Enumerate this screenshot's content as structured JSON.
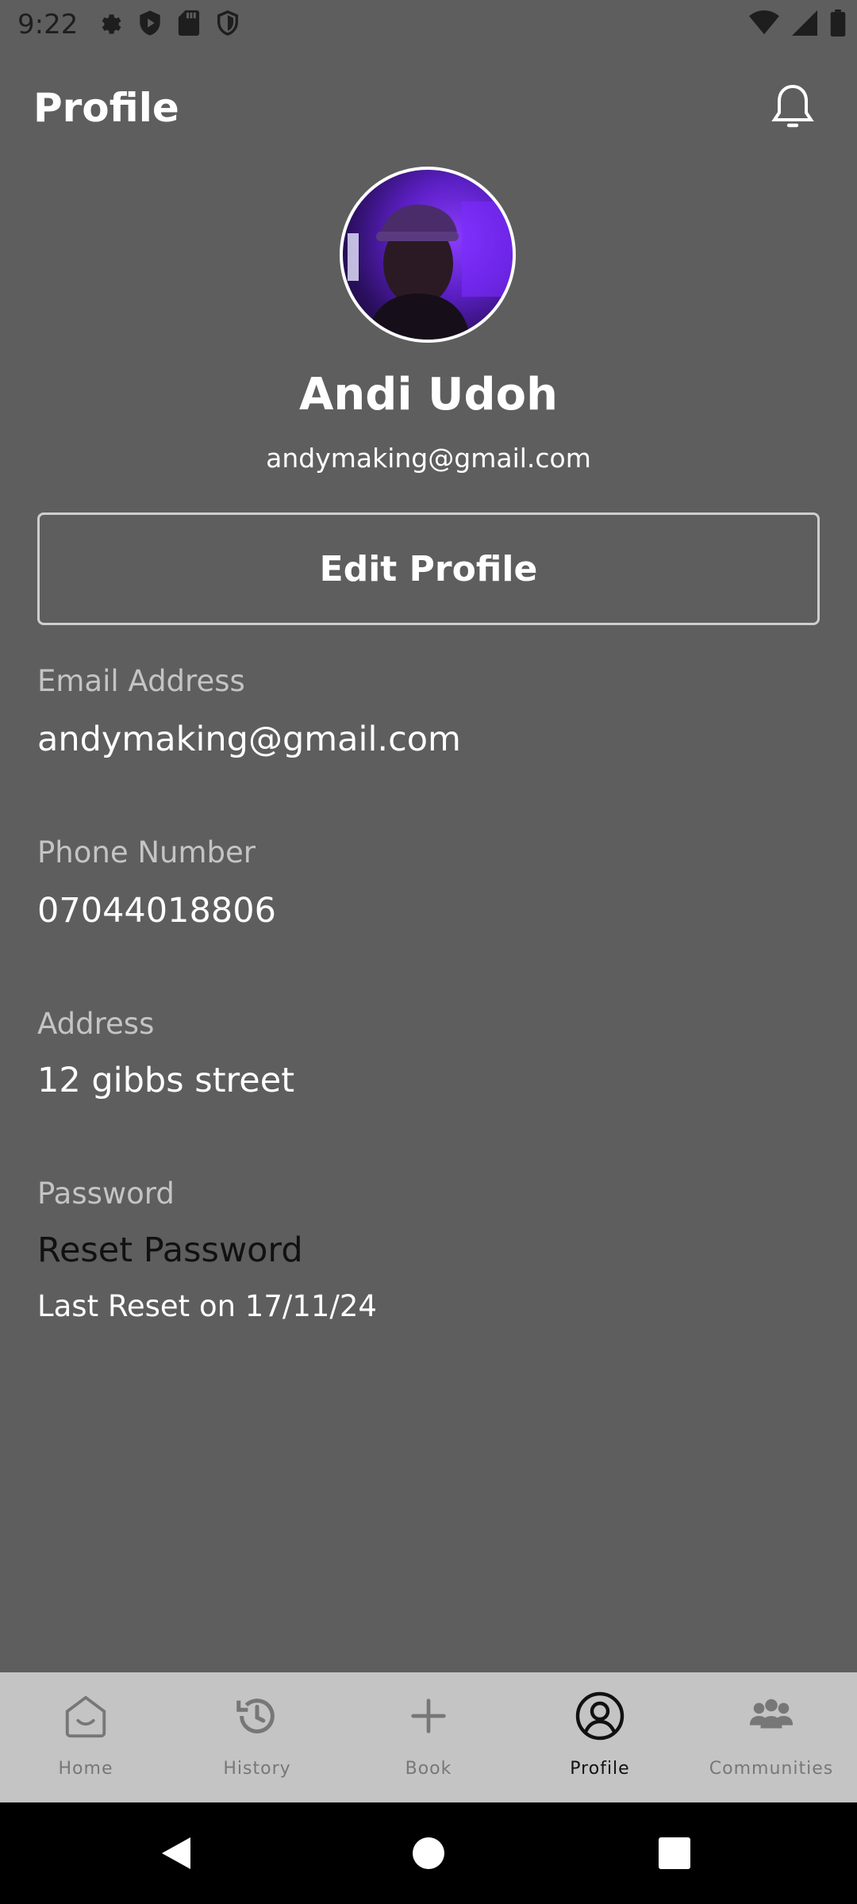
{
  "status_bar": {
    "time": "9:22",
    "left_icons": [
      "settings-icon",
      "shield-icon",
      "sd-card-icon",
      "vpn-shield-icon"
    ],
    "right_icons": [
      "wifi-icon",
      "signal-icon",
      "battery-icon"
    ]
  },
  "header": {
    "title": "Profile",
    "notification_icon": "bell-icon"
  },
  "profile": {
    "name": "Andi Udoh",
    "email": "andymaking@gmail.com",
    "edit_button_label": "Edit Profile"
  },
  "fields": {
    "email": {
      "label": "Email Address",
      "value": "andymaking@gmail.com"
    },
    "phone": {
      "label": "Phone Number",
      "value": "07044018806"
    },
    "address": {
      "label": "Address",
      "value": "12 gibbs street"
    },
    "password": {
      "label": "Password",
      "action": "Reset Password",
      "note": "Last Reset on 17/11/24"
    }
  },
  "bottom_nav": {
    "items": [
      {
        "label": "Home",
        "icon": "home-icon",
        "active": false
      },
      {
        "label": "History",
        "icon": "history-icon",
        "active": false
      },
      {
        "label": "Book",
        "icon": "plus-icon",
        "active": false
      },
      {
        "label": "Profile",
        "icon": "profile-icon",
        "active": true
      },
      {
        "label": "Communities",
        "icon": "people-icon",
        "active": false
      }
    ]
  },
  "colors": {
    "background": "#5e5e5e",
    "nav_background": "#c4c4c4",
    "nav_inactive": "#777777",
    "nav_active": "#111111",
    "avatar_accent": "#8a3cff"
  }
}
